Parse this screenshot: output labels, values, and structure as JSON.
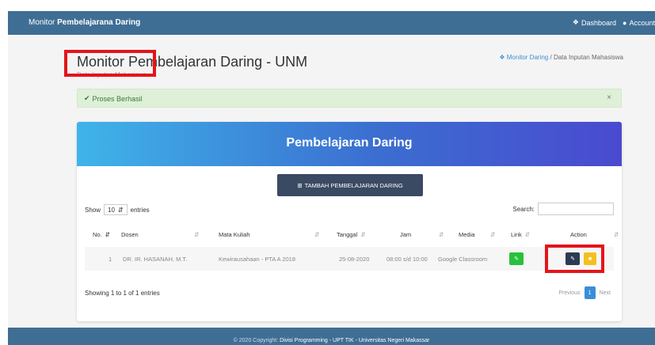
{
  "navbar": {
    "brand_prefix": "Monitor",
    "brand_rest": "Pembelajarana Daring",
    "dashboard_label": "Dashboard",
    "account_label": "Account"
  },
  "header": {
    "title": "Monitor Pembelajaran Daring - UNM",
    "subtitle": "Data Inputan Mahasiswa",
    "breadcrumb_home": "Monitor Daring",
    "breadcrumb_sep": "/",
    "breadcrumb_current": "Data Inputan Mahasiswa"
  },
  "alert": {
    "message": "Proses Berhasil",
    "close": "×"
  },
  "card": {
    "title": "Pembelajaran Daring",
    "add_button": "TAMBAH PEMBELAJARAN DARING"
  },
  "table_controls": {
    "show_label": "Show",
    "entries_value": "10",
    "entries_label": "entries",
    "search_label": "Search:"
  },
  "table": {
    "columns": [
      "No.",
      "Dosen",
      "Mata Kuliah",
      "Tanggal",
      "Jam",
      "Media",
      "Link",
      "Action"
    ],
    "rows": [
      {
        "no": "1",
        "dosen": "DR. IR. HASANAH, M.T.",
        "mata_kuliah": "Kewirausahaan - PTA A 2018",
        "tanggal": "25-08-2020",
        "jam": "08:00 s/d 10:00",
        "media": "Google Classroom"
      }
    ]
  },
  "footer_table": {
    "showing": "Showing 1 to 1 of 1 entries",
    "previous": "Previous",
    "current_page": "1",
    "next": "Next"
  },
  "footer": {
    "prefix": "© 2020 Copyright:",
    "strong": "Divisi Programming - UPT TIK - Universitas Negeri Makassar"
  },
  "colors": {
    "navbar": "#3f6e95",
    "alert_bg": "#dff0d8",
    "highlight": "#e4141a",
    "link_button": "#28c13a",
    "edit_button": "#2c3a52",
    "delete_button": "#f4c020"
  }
}
